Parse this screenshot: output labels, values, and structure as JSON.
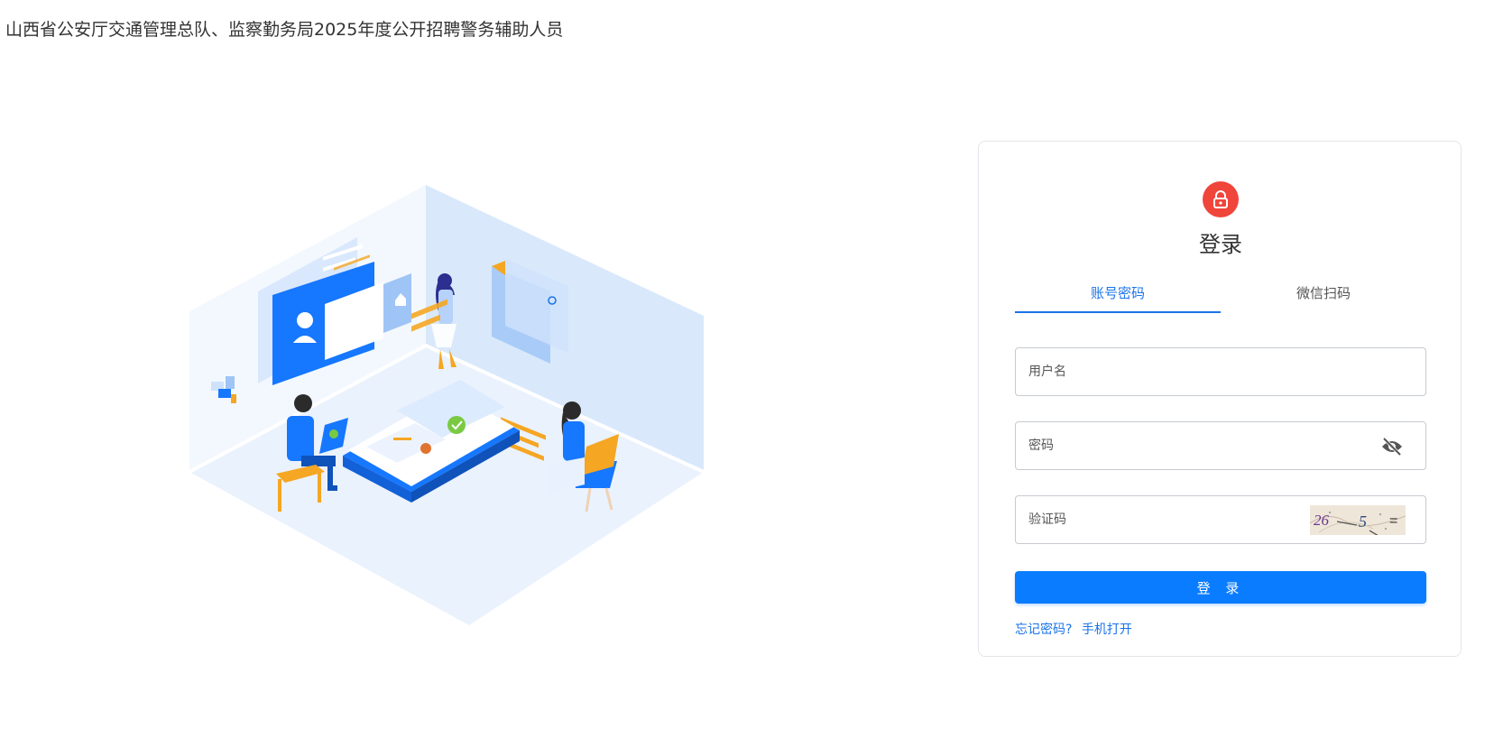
{
  "header": {
    "title": "山西省公安厅交通管理总队、监察勤务局2025年度公开招聘警务辅助人员"
  },
  "login": {
    "lock_icon": "lock-icon",
    "title": "登录",
    "tabs": [
      {
        "label": "账号密码",
        "active": true
      },
      {
        "label": "微信扫码",
        "active": false
      }
    ],
    "username": {
      "placeholder": "用户名",
      "value": ""
    },
    "password": {
      "placeholder": "密码",
      "value": "",
      "toggle_icon": "eye-off-icon"
    },
    "captcha": {
      "placeholder": "验证码",
      "value": "",
      "image_text": "26 - 5 ="
    },
    "submit_label": "登 录",
    "links": {
      "forgot": "忘记密码?",
      "mobile": "手机打开"
    }
  },
  "colors": {
    "accent": "#1a73e8",
    "button": "#0a7cff",
    "lock_badge": "#f0453b",
    "illustration_base": "#e3efff",
    "illustration_blue": "#1677ff",
    "illustration_orange": "#f5a623"
  }
}
